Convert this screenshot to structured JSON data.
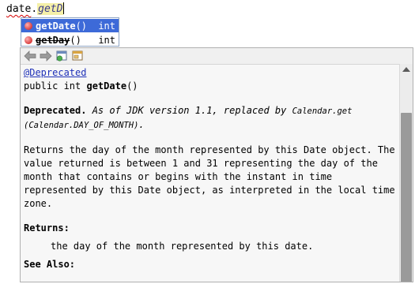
{
  "editor": {
    "object": "date",
    "dot": ".",
    "typed": "getD"
  },
  "completion": {
    "items": [
      {
        "name": "getDate",
        "params": "()",
        "type": "int",
        "selected": true,
        "deprecated": false
      },
      {
        "name": "getDay",
        "params": "()",
        "type": "int",
        "selected": false,
        "deprecated": true
      }
    ]
  },
  "javadoc": {
    "toolbar": {
      "icons": [
        "back-arrow-icon",
        "forward-arrow-icon",
        "open-declaration-icon",
        "open-external-doc-icon"
      ]
    },
    "annotation": "@Deprecated",
    "signature_prefix": "public int ",
    "signature_name": "getDate",
    "signature_suffix": "()",
    "deprecated_label": "Deprecated.",
    "deprecated_text": " As of JDK version 1.1, replaced by ",
    "deprecated_code1": "Calendar.get",
    "deprecated_code2": "(Calendar.DAY_OF_MONTH)",
    "deprecated_end": ".",
    "description": "Returns the day of the month represented by this Date object. The value returned is between 1 and 31 representing the day of the month that contains or begins with the instant in time represented by this Date object, as interpreted in the local time zone.",
    "returns_label": "Returns:",
    "returns_text": "the day of the month represented by this date.",
    "see_also_label": "See Also:"
  },
  "colors": {
    "selection": "#3d6ad8",
    "link": "#1f31b8",
    "highlight": "#f5f0a8"
  }
}
